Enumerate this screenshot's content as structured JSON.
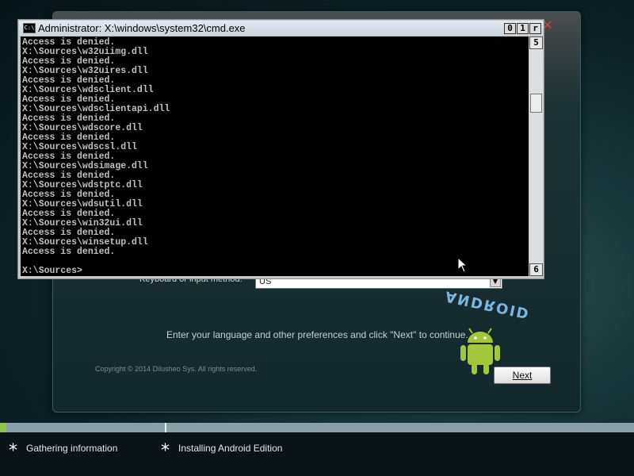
{
  "setup": {
    "input_method_label": "Keyboard or input method:",
    "input_method_value": "US",
    "instruction": "Enter your language and other preferences and click \"Next\" to continue.",
    "copyright": "Copyright © 2014 Dilusheo Sys. All rights reserved.",
    "next_label": "Next",
    "logo_text": "ANDROID",
    "close_glyph": "✕"
  },
  "cmd": {
    "title": "Administrator: X:\\windows\\system32\\cmd.exe",
    "icon_text": "C:\\",
    "ctrl_min": "0",
    "ctrl_max": "1",
    "ctrl_close": "r",
    "scroll_up": "5",
    "scroll_down": "6",
    "lines": [
      "Access is denied.",
      "X:\\Sources\\w32uiimg.dll",
      "Access is denied.",
      "X:\\Sources\\w32uires.dll",
      "Access is denied.",
      "X:\\Sources\\wdsclient.dll",
      "Access is denied.",
      "X:\\Sources\\wdsclientapi.dll",
      "Access is denied.",
      "X:\\Sources\\wdscore.dll",
      "Access is denied.",
      "X:\\Sources\\wdscsl.dll",
      "Access is denied.",
      "X:\\Sources\\wdsimage.dll",
      "Access is denied.",
      "X:\\Sources\\wdstptc.dll",
      "Access is denied.",
      "X:\\Sources\\wdsutil.dll",
      "Access is denied.",
      "X:\\Sources\\win32ui.dll",
      "Access is denied.",
      "X:\\Sources\\winsetup.dll",
      "Access is denied."
    ],
    "prompt": "X:\\Sources>"
  },
  "progress": {
    "fraction": 0.01
  },
  "steps": [
    {
      "label": "Gathering information"
    },
    {
      "label": "Installing Android Edition"
    }
  ]
}
